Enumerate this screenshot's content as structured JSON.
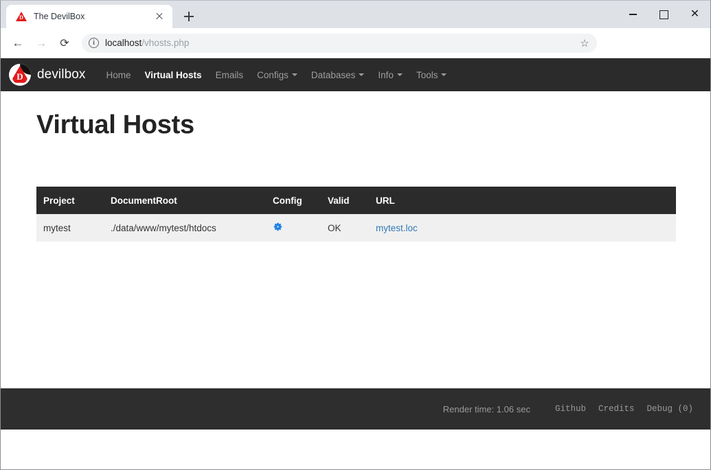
{
  "browser": {
    "tab": {
      "title": "The DevilBox",
      "favicon": "devilbox-triangle-icon",
      "favicon_letter": "D",
      "close_label": "×"
    },
    "new_tab_label": "+",
    "window_controls": {
      "minimize": "–",
      "maximize": "□",
      "close": "✕"
    },
    "toolbar": {
      "back_icon": "←",
      "forward_icon": "→",
      "reload_icon": "⟳",
      "site_info_icon": "i",
      "url_host": "localhost",
      "url_path": "/vhosts.php",
      "bookmark_icon": "☆"
    }
  },
  "navbar": {
    "brand": "devilbox",
    "logo_letter": "D",
    "items": [
      {
        "label": "Home",
        "active": false,
        "caret": false
      },
      {
        "label": "Virtual Hosts",
        "active": true,
        "caret": false
      },
      {
        "label": "Emails",
        "active": false,
        "caret": false
      },
      {
        "label": "Configs",
        "active": false,
        "caret": true
      },
      {
        "label": "Databases",
        "active": false,
        "caret": true
      },
      {
        "label": "Info",
        "active": false,
        "caret": true
      },
      {
        "label": "Tools",
        "active": false,
        "caret": true
      }
    ]
  },
  "page": {
    "title": "Virtual Hosts"
  },
  "table": {
    "columns": [
      "Project",
      "DocumentRoot",
      "Config",
      "Valid",
      "URL"
    ],
    "rows": [
      {
        "project": "mytest",
        "documentroot": "./data/www/mytest/htdocs",
        "config_icon": "gear-icon",
        "valid": "OK",
        "url": "mytest.loc"
      }
    ]
  },
  "footer": {
    "render_time": "Render time: 1.06 sec",
    "links": [
      "Github",
      "Credits",
      "Debug (0)"
    ]
  },
  "colors": {
    "navbar_bg": "#2b2b2b",
    "footer_bg": "#2e2e2e",
    "valid_ok_bg": "#5cb85c",
    "link_blue": "#337ab7",
    "gear_blue": "#1b80e3",
    "brand_red": "#e21b1b",
    "row_bg": "#f0f0f0"
  }
}
